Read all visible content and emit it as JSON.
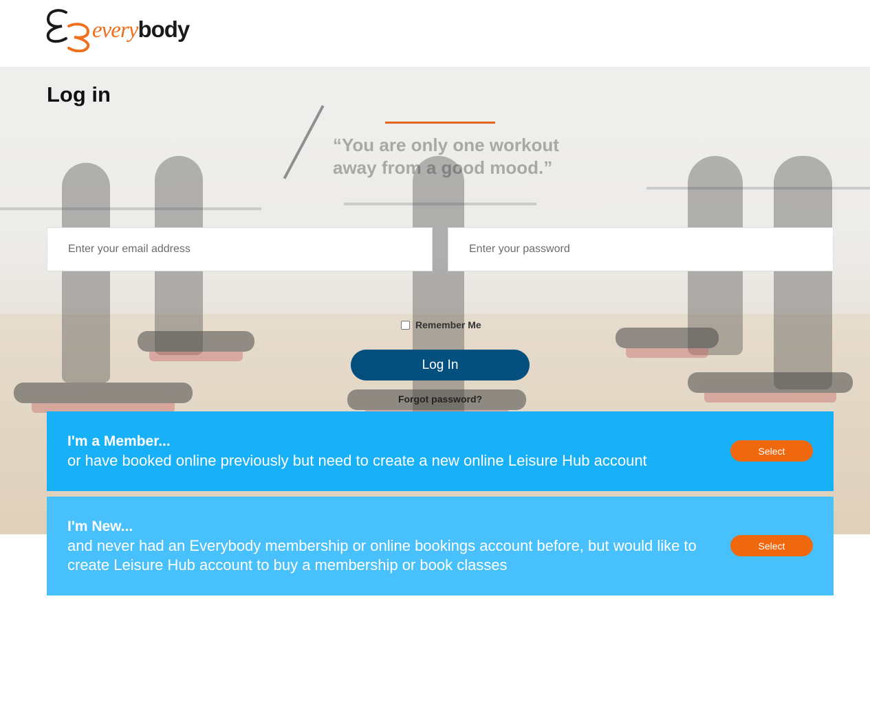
{
  "brand": {
    "logo_prefix": "every",
    "logo_suffix": "body",
    "accent_color": "#ee6f1e",
    "logo_icon": "interlocking-e-icon"
  },
  "hero": {
    "quote": "“You are only one workout away from a good mood.”"
  },
  "login": {
    "title": "Log in",
    "email_placeholder": "Enter your email address",
    "email_value": "",
    "password_placeholder": "Enter your password",
    "password_value": "",
    "remember_label": "Remember Me",
    "remember_checked": false,
    "submit_label": "Log In",
    "forgot_label": "Forgot password?",
    "button_color": "#034f7e"
  },
  "options": {
    "member": {
      "title": "I'm a Member...",
      "description": "or have booked online previously but need to create a new online Leisure Hub account",
      "button_label": "Select",
      "color": "#18b0f7"
    },
    "new": {
      "title": "I'm New...",
      "description": "and never had an Everybody membership or online bookings account before, but would like to create Leisure Hub account to buy a membership or book classes",
      "button_label": "Select",
      "color": "#47c0fb"
    },
    "select_color": "#f0680e"
  }
}
